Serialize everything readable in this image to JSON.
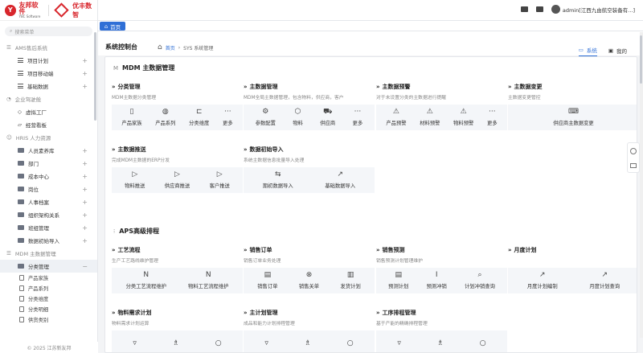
{
  "brand": {
    "logo1_cn": "友邦软件",
    "logo1_en": "YBC Software",
    "logo2_cn": "优丰数智"
  },
  "sidebar": {
    "search_placeholder": "搜索菜单",
    "groups": [
      {
        "label": "AMS售后系统",
        "items": [
          {
            "label": "项目计划"
          },
          {
            "label": "项目移动端"
          },
          {
            "label": "基础数据"
          }
        ]
      },
      {
        "label": "企业驾驶舱",
        "items": [
          {
            "label": "虚拟工厂"
          },
          {
            "label": "经营看板"
          }
        ]
      },
      {
        "label": "HRIS 人力资源",
        "items": [
          {
            "label": "人员素养库"
          },
          {
            "label": "部门"
          },
          {
            "label": "成本中心"
          },
          {
            "label": "岗位"
          },
          {
            "label": "人事档案"
          },
          {
            "label": "组织架构关系"
          },
          {
            "label": "班组管理"
          },
          {
            "label": "数据初始导入"
          }
        ]
      },
      {
        "label": "MDM 主数据管理",
        "items": [
          {
            "label": "分类管理"
          }
        ]
      }
    ],
    "subitems": [
      {
        "label": "产品家族"
      },
      {
        "label": "产品系列"
      },
      {
        "label": "分类维度"
      },
      {
        "label": "分类明细"
      },
      {
        "label": "供货类别"
      }
    ],
    "footer": "© 2025 江苏新友邦"
  },
  "header": {
    "user": "admin[江西九由航空装备有...]"
  },
  "tabs": {
    "home": "首页"
  },
  "page": {
    "title": "系统控制台",
    "crumb_home": "首页",
    "crumb_current": "SYS 系统管理",
    "view_tabs": [
      {
        "label": "系统"
      },
      {
        "label": "我的"
      }
    ]
  },
  "sections": [
    {
      "title": "MDM 主数据管理",
      "mark": "M",
      "cards": [
        {
          "title": "分类管理",
          "desc": "MDM主数据分类管理",
          "tools": [
            {
              "label": "产品家族",
              "icon": "▯"
            },
            {
              "label": "产品系列",
              "icon": "◍"
            },
            {
              "label": "分类维度",
              "icon": "⊏"
            },
            {
              "label": "更多",
              "icon": "···"
            }
          ]
        },
        {
          "title": "主数据管理",
          "desc": "MDM全局主数据管理，包含物料，供应商，客户",
          "tools": [
            {
              "label": "参数配置",
              "icon": "⚙"
            },
            {
              "label": "物料",
              "icon": "⬡"
            },
            {
              "label": "供应商",
              "icon": "⛟"
            },
            {
              "label": "更多",
              "icon": "···"
            }
          ]
        },
        {
          "title": "主数据预警",
          "desc": "对于未设置分类的主数据进行提醒",
          "tools": [
            {
              "label": "产品预警",
              "icon": "⚠"
            },
            {
              "label": "材料预警",
              "icon": "⚠"
            },
            {
              "label": "物料预警",
              "icon": "⚠"
            },
            {
              "label": "更多",
              "icon": "···"
            }
          ]
        },
        {
          "title": "主数据变更",
          "desc": "主数据变更管控",
          "tools": [
            {
              "label": "供应商主数据变更",
              "icon": "⌨"
            }
          ]
        },
        {
          "title": "主数据推送",
          "desc": "完成MDM主数据的ERP分发",
          "tools": [
            {
              "label": "物料推送",
              "icon": "▷"
            },
            {
              "label": "供应商推送",
              "icon": "▷"
            },
            {
              "label": "客户推送",
              "icon": "▷"
            }
          ]
        },
        {
          "title": "数据初始导入",
          "desc": "系统主数据信息批量导入处理",
          "tools": [
            {
              "label": "期初数据导入",
              "icon": "⇆"
            },
            {
              "label": "基础数据导入",
              "icon": "↗"
            }
          ]
        }
      ]
    },
    {
      "title": "APS高级排程",
      "mark": "",
      "cards": [
        {
          "title": "工艺流程",
          "desc": "生产工艺路线维护管理",
          "tools": [
            {
              "label": "分类工艺流程维护",
              "icon": "N"
            },
            {
              "label": "物料工艺流程维护",
              "icon": "N"
            }
          ]
        },
        {
          "title": "销售订单",
          "desc": "销售订单业务处理",
          "tools": [
            {
              "label": "销售订单",
              "icon": "▤"
            },
            {
              "label": "销售关单",
              "icon": "⊗"
            },
            {
              "label": "发货计划",
              "icon": "▥"
            }
          ]
        },
        {
          "title": "销售预测",
          "desc": "销售预测计划管理维护",
          "tools": [
            {
              "label": "预测计划",
              "icon": "▤"
            },
            {
              "label": "预测冲销",
              "icon": "I"
            },
            {
              "label": "计划冲销查询",
              "icon": "⌕"
            }
          ]
        },
        {
          "title": "月度计划",
          "desc": "",
          "tools": [
            {
              "label": "月度计划编制",
              "icon": "↗"
            },
            {
              "label": "月度计划查询",
              "icon": "↗"
            }
          ]
        },
        {
          "title": "物料需求计划",
          "desc": "物料需求计划运算",
          "tools": []
        },
        {
          "title": "主计划管理",
          "desc": "成品和能力计划排程管理",
          "tools": []
        },
        {
          "title": "工序排程管理",
          "desc": "基于产能的精确排程管理",
          "tools": []
        }
      ]
    }
  ]
}
